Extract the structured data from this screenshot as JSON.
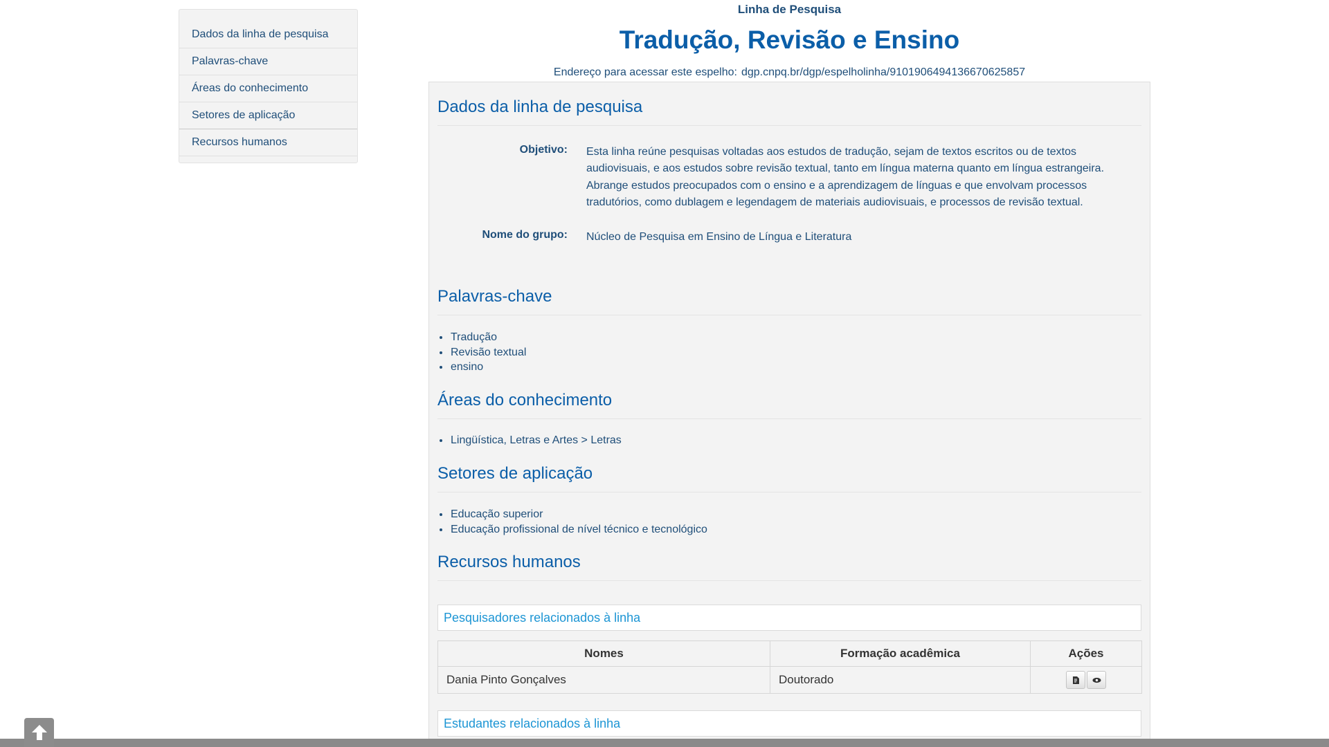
{
  "sidebar": {
    "items": [
      {
        "label": "Dados da linha de pesquisa"
      },
      {
        "label": "Palavras-chave"
      },
      {
        "label": "Áreas do conhecimento"
      },
      {
        "label": "Setores de aplicação"
      },
      {
        "label": "Recursos humanos"
      }
    ]
  },
  "header": {
    "kicker": "Linha de Pesquisa",
    "title": "Tradução, Revisão e Ensino",
    "address_label": "Endereço para acessar este espelho:",
    "address_url": "dgp.cnpq.br/dgp/espelholinha/9101906494136670625857"
  },
  "dados": {
    "heading": "Dados da linha de pesquisa",
    "objetivo_label": "Objetivo:",
    "objetivo_lines": [
      "Esta linha reúne pesquisas voltadas aos estudos de tradução, sejam de textos escritos ou de textos",
      "audiovisuais, e aos estudos sobre revisão textual, tanto em língua materna quanto em língua estrangeira.",
      "Abrange estudos preocupados com o ensino e a aprendizagem de línguas e que envolvam processos",
      "tradutórios, como dublagem e legendagem de materiais audiovisuais, e processos de revisão textual."
    ],
    "grupo_label": "Nome do grupo:",
    "grupo_value": "Núcleo de Pesquisa em Ensino de Língua e Literatura"
  },
  "palavras": {
    "heading": "Palavras-chave",
    "items": [
      "Tradução",
      "Revisão textual",
      "ensino"
    ]
  },
  "areas": {
    "heading": "Áreas do conhecimento",
    "items": [
      "Lingüística, Letras e Artes > Letras"
    ]
  },
  "setores": {
    "heading": "Setores de aplicação",
    "items": [
      "Educação superior",
      "Educação profissional de nível técnico e tecnológico"
    ]
  },
  "recursos": {
    "heading": "Recursos humanos",
    "pesquisadores_title": "Pesquisadores relacionados à linha",
    "table": {
      "headers": [
        "Nomes",
        "Formação acadêmica",
        "Ações"
      ],
      "rows": [
        {
          "nome": "Dania Pinto Gonçalves",
          "formacao": "Doutorado"
        }
      ]
    },
    "estudantes_title": "Estudantes relacionados à linha"
  },
  "icons": {
    "lattes": "curriculum-icon",
    "view": "eye-icon",
    "back_to_top": "arrow-up-icon"
  }
}
